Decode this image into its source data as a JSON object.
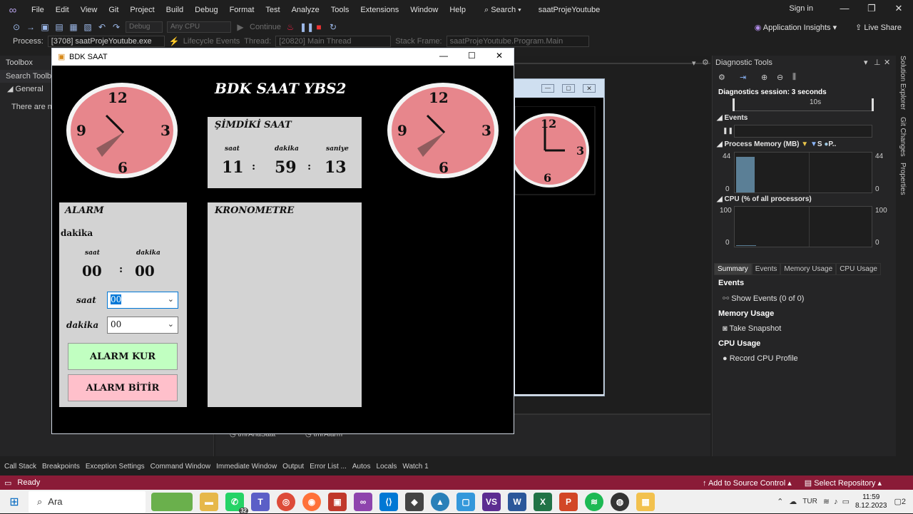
{
  "vs": {
    "menus": [
      "File",
      "Edit",
      "View",
      "Git",
      "Project",
      "Build",
      "Debug",
      "Format",
      "Test",
      "Analyze",
      "Tools",
      "Extensions",
      "Window",
      "Help"
    ],
    "search_label": "Search",
    "solution_name": "saatProjeYoutube",
    "signin": "Sign in",
    "toolbar1": {
      "config": "Debug",
      "platform": "Any CPU",
      "continue": "Continue",
      "app_insights": "Application Insights",
      "live_share": "Live Share"
    },
    "toolbar2": {
      "process_label": "Process:",
      "process_value": "[3708] saatProjeYoutube.exe",
      "lifecycle": "Lifecycle Events",
      "thread_label": "Thread:",
      "thread_value": "[20820] Main Thread",
      "stack_label": "Stack Frame:",
      "stack_value": "saatProjeYoutube.Program.Main"
    },
    "toolbox": {
      "title": "Toolbox",
      "search": "Search Toolbo",
      "general": "General",
      "note": "There are no"
    },
    "diag": {
      "title": "Diagnostic Tools",
      "session": "Diagnostics session: 3 seconds",
      "timeline_tick": "10s",
      "events": "Events",
      "memory_title": "Process Memory (MB)",
      "memory_legend": [
        "S",
        "P.."
      ],
      "memory_max": "44",
      "memory_min": "0",
      "cpu_title": "CPU (% of all processors)",
      "cpu_max": "100",
      "cpu_min": "0",
      "tabs": [
        "Summary",
        "Events",
        "Memory Usage",
        "CPU Usage"
      ],
      "events_section": "Events",
      "show_events": "Show Events (0 of 0)",
      "memory_section": "Memory Usage",
      "take_snapshot": "Take Snapshot",
      "cpu_section": "CPU Usage",
      "record_cpu": "Record CPU Profile"
    },
    "right_rail": [
      "Solution Explorer",
      "Git Changes",
      "Properties"
    ],
    "bottom_tabs": [
      "Call Stack",
      "Breakpoints",
      "Exception Settings",
      "Command Window",
      "Immediate Window",
      "Output",
      "Error List ...",
      "Autos",
      "Locals",
      "Watch 1"
    ],
    "editor_bottom": [
      "tmrAnaSaat",
      "tmrAlarm"
    ],
    "status": {
      "ready": "Ready",
      "add_source": "Add to Source Control",
      "select_repo": "Select Repository"
    }
  },
  "app": {
    "window_title": "BDK SAAT",
    "heading": "BDK SAAT  YBS2",
    "now_panel": {
      "title": "ŞİMDİKİ SAAT",
      "hour_label": "saat",
      "minute_label": "dakika",
      "second_label": "saniye",
      "hour": "11",
      "minute": "59",
      "second": "13",
      "sep": ":"
    },
    "alarm_panel": {
      "title": "ALARM",
      "subtitle": "dakika",
      "hour_label": "saat",
      "minute_label": "dakika",
      "hour": "00",
      "minute": "00",
      "sep": ":",
      "saat_field_label": "saat",
      "saat_field_value": "00",
      "dakika_field_label": "dakika",
      "dakika_field_value": "00",
      "set_button": "ALARM KUR",
      "stop_button": "ALARM BİTİR"
    },
    "stopwatch_panel": {
      "title": "KRONOMETRE"
    },
    "clock_numbers": [
      "12",
      "3",
      "6",
      "9"
    ]
  },
  "taskbar": {
    "search": "Ara",
    "whatsapp_badge": "32",
    "lang": "TUR",
    "time": "11:59",
    "date": "8.12.2023",
    "notif": "2"
  },
  "colors": {
    "status": "#8a1b37",
    "clock_face": "#e7868c",
    "alarm_set": "#c1ffc1",
    "alarm_stop": "#ffc0cb"
  }
}
